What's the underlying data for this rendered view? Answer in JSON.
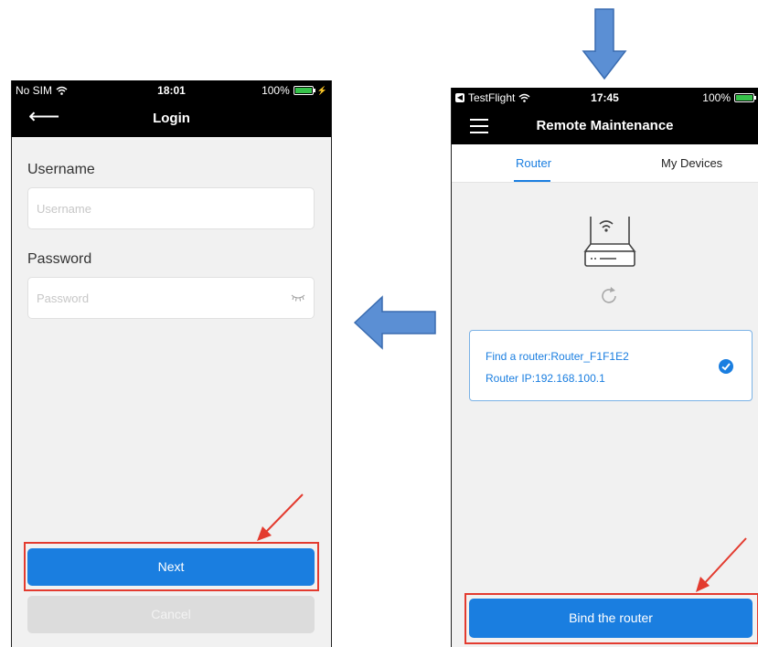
{
  "left_screen": {
    "status": {
      "carrier": "No SIM",
      "time": "18:01",
      "battery": "100%"
    },
    "nav_title": "Login",
    "username_label": "Username",
    "username_placeholder": "Username",
    "password_label": "Password",
    "password_placeholder": "Password",
    "next_label": "Next",
    "cancel_label": "Cancel"
  },
  "right_screen": {
    "status": {
      "carrier": "TestFlight",
      "time": "17:45",
      "battery": "100%"
    },
    "nav_title": "Remote Maintenance",
    "tabs": [
      {
        "label": "Router",
        "active": true
      },
      {
        "label": "My Devices",
        "active": false
      }
    ],
    "router_found": "Find a router:Router_F1F1E2",
    "router_ip": "Router IP:192.168.100.1",
    "bind_label": "Bind the router"
  },
  "colors": {
    "accent": "#1a7ee0",
    "annotation_red": "#e33b2f",
    "arrow_blue": "#5b8fd4"
  },
  "icons": [
    "back-arrow-icon",
    "hamburger-menu-icon",
    "wifi-icon",
    "battery-icon",
    "eye-closed-icon",
    "router-icon",
    "refresh-icon",
    "check-circle-icon"
  ]
}
